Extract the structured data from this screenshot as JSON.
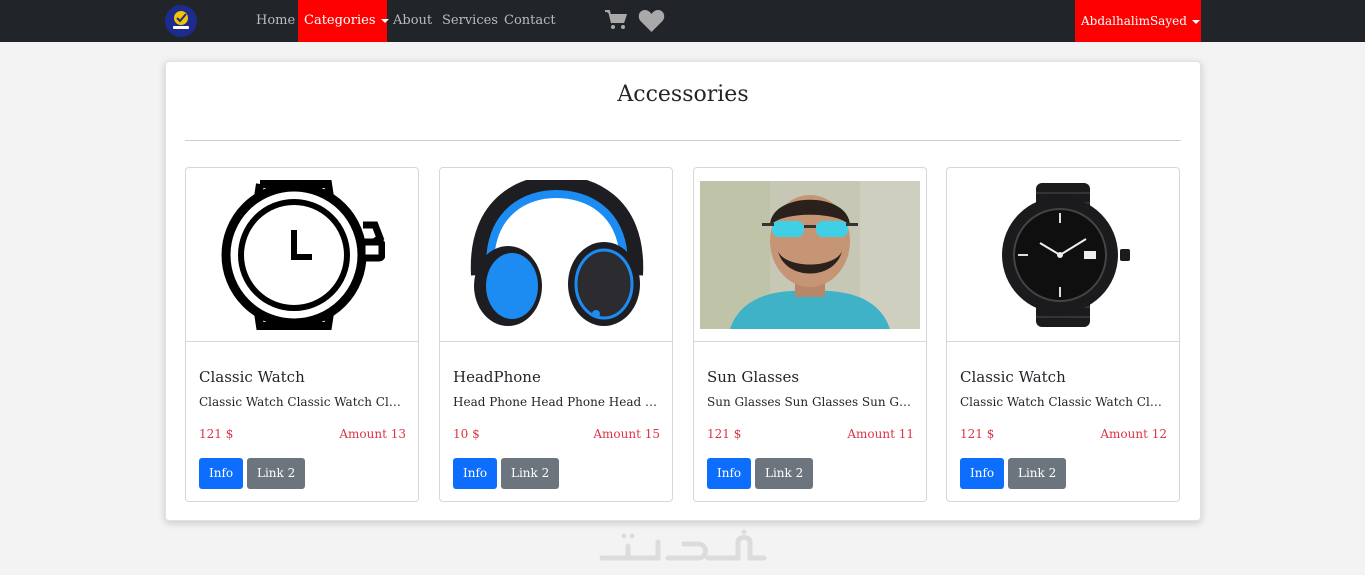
{
  "navbar": {
    "links": {
      "home": "Home",
      "categories": "Categories",
      "about": "About",
      "services": "Services",
      "contact": "Contact"
    },
    "user": "AbdalhalimSayed",
    "icons": [
      "shopping-cart-icon",
      "heart-icon"
    ],
    "accent_color": "#ff0000",
    "bg_color": "#212529"
  },
  "main": {
    "title": "Accessories"
  },
  "products": [
    {
      "title": "Classic Watch",
      "description": "Classic Watch Classic Watch Classic Watch",
      "price": "121 $",
      "amount": "Amount 13",
      "info_label": "Info",
      "link_label": "Link 2"
    },
    {
      "title": "HeadPhone",
      "description": "Head Phone Head Phone Head Phone",
      "price": "10 $",
      "amount": "Amount 15",
      "info_label": "Info",
      "link_label": "Link 2"
    },
    {
      "title": "Sun Glasses",
      "description": "Sun Glasses Sun Glasses Sun Glasses",
      "price": "121 $",
      "amount": "Amount 11",
      "info_label": "Info",
      "link_label": "Link 2"
    },
    {
      "title": "Classic Watch",
      "description": "Classic Watch Classic Watch Classic Watch",
      "price": "121 $",
      "amount": "Amount 12",
      "info_label": "Info",
      "link_label": "Link 2"
    }
  ],
  "colors": {
    "primary_button": "#0d6efd",
    "secondary_button": "#6c757d",
    "price_text": "#dc3545"
  }
}
